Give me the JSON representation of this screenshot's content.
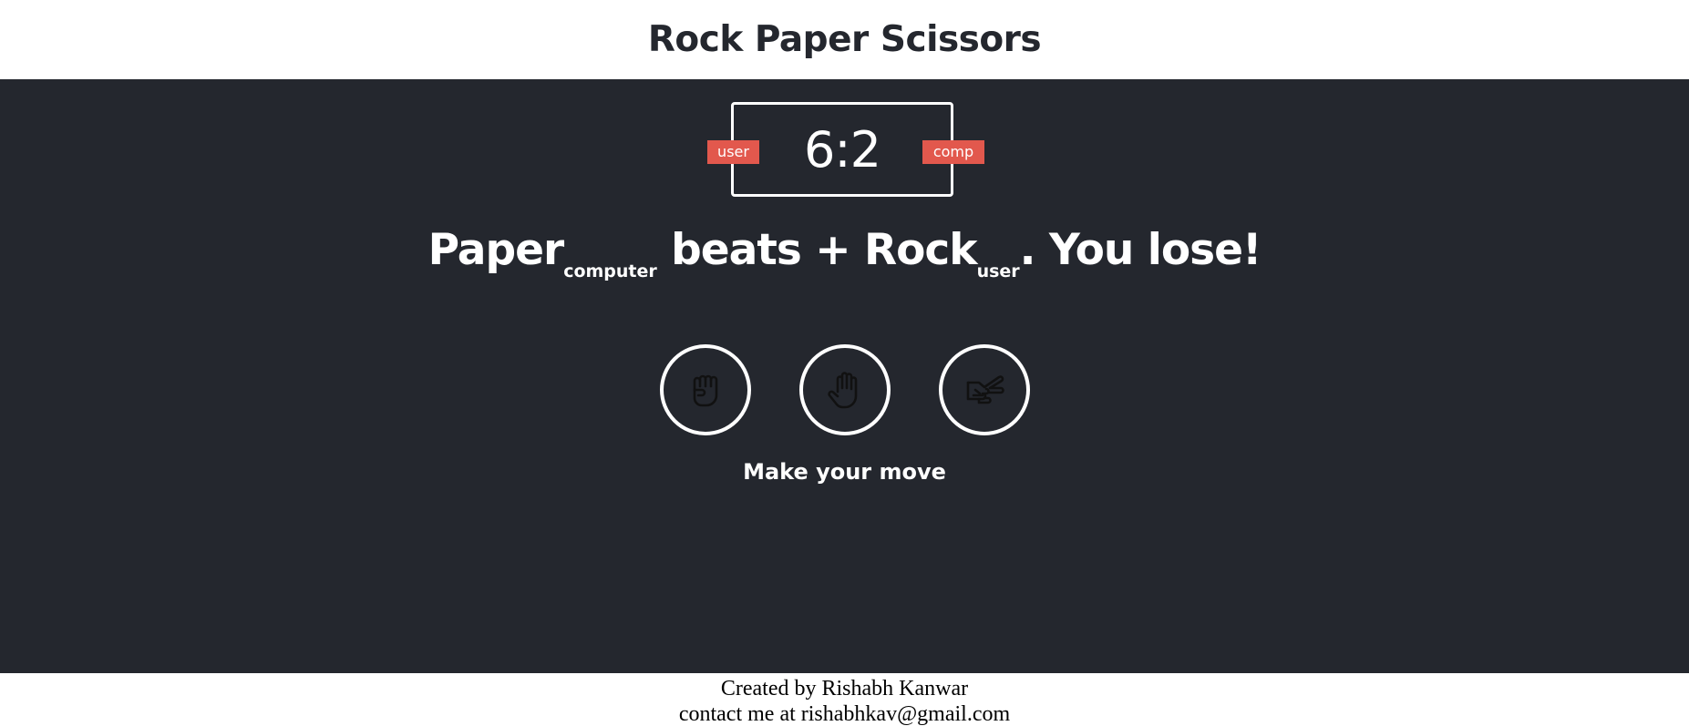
{
  "header": {
    "title": "Rock Paper Scissors"
  },
  "scoreboard": {
    "user_label": "user",
    "comp_label": "comp",
    "score": "6:2"
  },
  "result": {
    "computer_choice": "Paper",
    "computer_sub": "computer",
    "verb": "beats + ",
    "user_choice": "Rock",
    "user_sub": "user",
    "outcome": ". You lose!"
  },
  "choices": [
    {
      "name": "rock",
      "icon": "fist-icon"
    },
    {
      "name": "paper",
      "icon": "hand-icon"
    },
    {
      "name": "scissors",
      "icon": "scissors-hand-icon"
    }
  ],
  "prompt": "Make your move",
  "footer": {
    "credit": "Created by Rishabh Kanwar",
    "contact": "contact me at rishabhkav@gmail.com"
  },
  "colors": {
    "background": "#24272e",
    "accent": "#e2584d",
    "text": "#ffffff"
  }
}
